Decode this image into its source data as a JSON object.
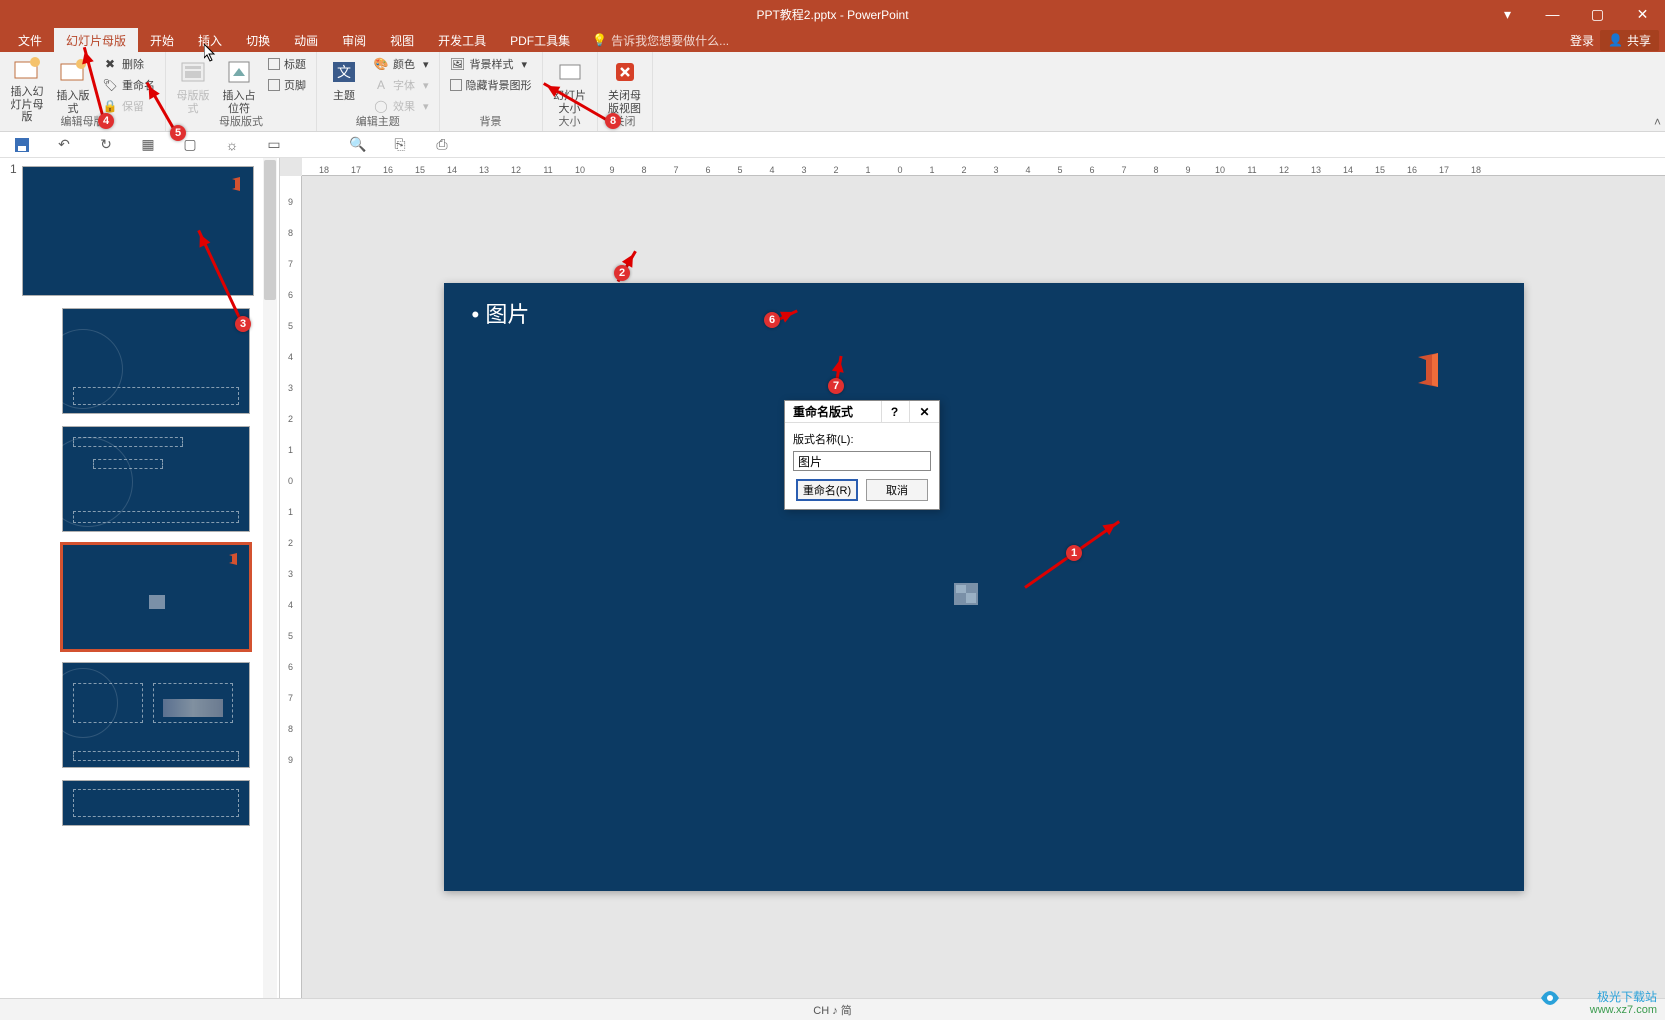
{
  "title": "PPT教程2.pptx - PowerPoint",
  "window_controls": {
    "min": "—",
    "max": "▢",
    "close": "✕",
    "ribbon_opts": "▾"
  },
  "tabs": {
    "file": "文件",
    "slide_master": "幻灯片母版",
    "home": "开始",
    "insert": "插入",
    "transitions": "切换",
    "animations": "动画",
    "review": "审阅",
    "view": "视图",
    "dev": "开发工具",
    "pdf": "PDF工具集",
    "search_hint": "告诉我您想要做什么...",
    "login": "登录",
    "share": "共享"
  },
  "ribbon": {
    "edit_master": {
      "insert_slide_master": "插入幻灯片母版",
      "insert_layout": "插入版式",
      "delete": "删除",
      "rename": "重命名",
      "preserve": "保留",
      "group": "编辑母版"
    },
    "master_layout": {
      "master_layout": "母版版式",
      "insert_placeholder": "插入占位符",
      "title_cb": "标题",
      "footer_cb": "页脚",
      "group": "母版版式"
    },
    "edit_theme": {
      "themes": "主题",
      "colors": "颜色",
      "fonts": "字体",
      "effects": "效果",
      "group": "编辑主题"
    },
    "background": {
      "bg_styles": "背景样式",
      "hide_bg": "隐藏背景图形",
      "group": "背景"
    },
    "size": {
      "slide_size": "幻灯片大小",
      "group": "大小"
    },
    "close": {
      "close_master": "关闭母版视图",
      "group": "关闭"
    }
  },
  "slide": {
    "placeholder_title": "图片"
  },
  "dialog": {
    "title": "重命名版式",
    "field_label": "版式名称(L):",
    "value": "图片",
    "rename_btn": "重命名(R)",
    "cancel_btn": "取消",
    "help": "?",
    "close": "✕"
  },
  "thumbs": {
    "master_number": "1"
  },
  "status": {
    "ime": "CH ♪ 简"
  },
  "watermark": {
    "brand": "极光下载站",
    "url": "www.xz7.com"
  },
  "ruler_h": [
    "18",
    "17",
    "16",
    "15",
    "14",
    "13",
    "12",
    "11",
    "10",
    "9",
    "8",
    "7",
    "6",
    "5",
    "4",
    "3",
    "2",
    "1",
    "0",
    "1",
    "2",
    "3",
    "4",
    "5",
    "6",
    "7",
    "8",
    "9",
    "10",
    "11",
    "12",
    "13",
    "14",
    "15",
    "16",
    "17",
    "18"
  ],
  "ruler_v": [
    "9",
    "8",
    "7",
    "6",
    "5",
    "4",
    "3",
    "2",
    "1",
    "0",
    "1",
    "2",
    "3",
    "4",
    "5",
    "6",
    "7",
    "8",
    "9"
  ],
  "annotations": {
    "n1": "1",
    "n2": "2",
    "n3": "3",
    "n4": "4",
    "n5": "5",
    "n6": "6",
    "n7": "7",
    "n8": "8"
  }
}
